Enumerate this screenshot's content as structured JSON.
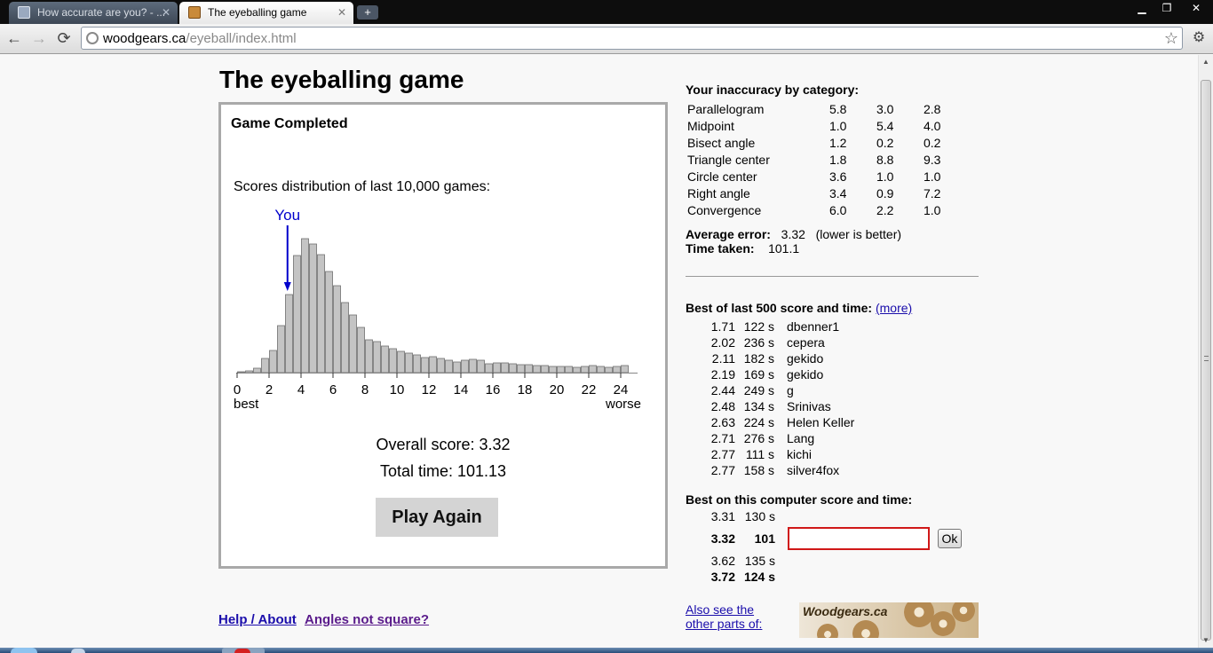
{
  "browser": {
    "tabs": [
      {
        "title": "How accurate are you? - ...",
        "active": false
      },
      {
        "title": "The eyeballing game",
        "active": true
      }
    ],
    "new_tab_label": "+",
    "window_controls": {
      "minimize": "▁",
      "restore": "❐",
      "close": "✕"
    },
    "nav": {
      "back": "←",
      "forward": "→",
      "reload": "⟳"
    },
    "url_domain": "woodgears.ca",
    "url_path": "/eyeball/index.html",
    "bookmark_star": "☆",
    "wrench": "⚙"
  },
  "page": {
    "title": "The eyeballing game",
    "game": {
      "status": "Game Completed",
      "distribution_caption": "Scores distribution of last 10,000 games:",
      "you_label": "You",
      "overall_score_text": "Overall score: 3.32",
      "total_time_text": "Total time: 101.13",
      "play_again_label": "Play Again"
    },
    "links": {
      "help": "Help / About",
      "angles": "Angles not square?"
    },
    "categories": {
      "heading": "Your inaccuracy by category:",
      "rows": [
        {
          "name": "Parallelogram",
          "v1": "5.8",
          "v2": "3.0",
          "v3": "2.8"
        },
        {
          "name": "Midpoint",
          "v1": "1.0",
          "v2": "5.4",
          "v3": "4.0"
        },
        {
          "name": "Bisect angle",
          "v1": "1.2",
          "v2": "0.2",
          "v3": "0.2"
        },
        {
          "name": "Triangle center",
          "v1": "1.8",
          "v2": "8.8",
          "v3": "9.3"
        },
        {
          "name": "Circle center",
          "v1": "3.6",
          "v2": "1.0",
          "v3": "1.0"
        },
        {
          "name": "Right angle",
          "v1": "3.4",
          "v2": "0.9",
          "v3": "7.2"
        },
        {
          "name": "Convergence",
          "v1": "6.0",
          "v2": "2.2",
          "v3": "1.0"
        }
      ]
    },
    "average_error": {
      "label": "Average error:",
      "value": "3.32",
      "note": "(lower is better)"
    },
    "time_taken": {
      "label": "Time taken:",
      "value": "101.1"
    },
    "best500": {
      "heading": "Best of last 500 score and time:",
      "more_link": "(more)",
      "rows": [
        {
          "score": "1.71",
          "time": "122 s",
          "name": "dbenner1"
        },
        {
          "score": "2.02",
          "time": "236 s",
          "name": "cepera"
        },
        {
          "score": "2.11",
          "time": "182 s",
          "name": "gekido"
        },
        {
          "score": "2.19",
          "time": "169 s",
          "name": "gekido"
        },
        {
          "score": "2.44",
          "time": "249 s",
          "name": "g"
        },
        {
          "score": "2.48",
          "time": "134 s",
          "name": "Srinivas"
        },
        {
          "score": "2.63",
          "time": "224 s",
          "name": "Helen Keller"
        },
        {
          "score": "2.71",
          "time": "276 s",
          "name": "Lang"
        },
        {
          "score": "2.77",
          "time": "111 s",
          "name": "kichi"
        },
        {
          "score": "2.77",
          "time": "158 s",
          "name": "silver4fox"
        }
      ]
    },
    "best_computer": {
      "heading": "Best on this computer score and time:",
      "rows": [
        {
          "score": "3.31",
          "time": "130 s",
          "bold": false
        },
        {
          "score": "3.32",
          "time": "101",
          "bold": true
        },
        {
          "score": "3.62",
          "time": "135 s",
          "bold": false
        },
        {
          "score": "3.72",
          "time": "124 s",
          "bold": true
        }
      ],
      "name_input_value": "",
      "ok_label": "Ok"
    },
    "see_also": "Also see the other parts of:",
    "banner_text": "Woodgears.ca"
  },
  "chart_data": {
    "type": "bar",
    "title": "Scores distribution of last 10,000 games:",
    "bin_width": 0.5,
    "x_start": 0.25,
    "x": [
      0.25,
      0.75,
      1.25,
      1.75,
      2.25,
      2.75,
      3.25,
      3.75,
      4.25,
      4.75,
      5.25,
      5.75,
      6.25,
      6.75,
      7.25,
      7.75,
      8.25,
      8.75,
      9.25,
      9.75,
      10.25,
      10.75,
      11.25,
      11.75,
      12.25,
      12.75,
      13.25,
      13.75,
      14.25,
      14.75,
      15.25,
      15.75,
      16.25,
      16.75,
      17.25,
      17.75,
      18.25,
      18.75,
      19.25,
      19.75,
      20.25,
      20.75,
      21.25,
      21.75,
      22.25,
      22.75,
      23.25,
      23.75,
      24.25,
      24.75
    ],
    "values": [
      1,
      2,
      5,
      16,
      25,
      53,
      88,
      132,
      151,
      145,
      133,
      114,
      98,
      79,
      65,
      51,
      37,
      35,
      30,
      27,
      24,
      22,
      20,
      17,
      18,
      16,
      14,
      12,
      14,
      15,
      14,
      10,
      11,
      11,
      10,
      9,
      9,
      8,
      8,
      7,
      7,
      7,
      6,
      7,
      8,
      7,
      6,
      7,
      8,
      0
    ],
    "ylim": [
      0,
      160
    ],
    "xlim": [
      0,
      25
    ],
    "x_ticks": [
      "0",
      "2",
      "4",
      "6",
      "8",
      "10",
      "12",
      "14",
      "16",
      "18",
      "20",
      "22",
      "24"
    ],
    "x_tick_values": [
      0,
      2,
      4,
      6,
      8,
      10,
      12,
      14,
      16,
      18,
      20,
      22,
      24
    ],
    "left_label": "best",
    "right_label": "worse",
    "marker": {
      "label": "You",
      "x": 3.32
    },
    "bar_color": "#c4c4c4",
    "bar_edge": "#6f6f6f",
    "marker_color": "#0000cc"
  }
}
